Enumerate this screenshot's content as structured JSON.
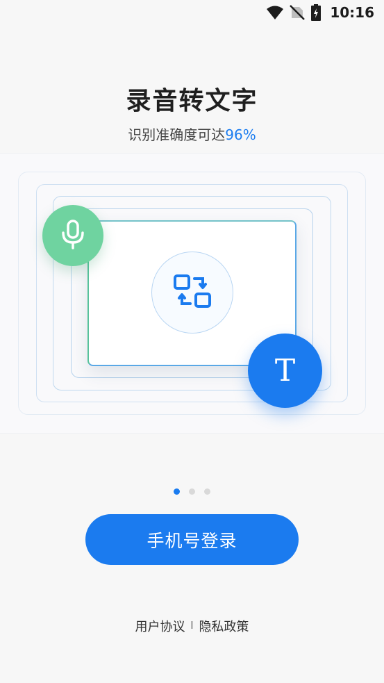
{
  "status_bar": {
    "time": "10:16",
    "icons": [
      "wifi-icon",
      "no-sim-icon",
      "battery-charging-icon"
    ]
  },
  "header": {
    "title": "录音转文字",
    "subtitle_prefix": "识别准确度可达",
    "subtitle_accent": "96%"
  },
  "illustration": {
    "mic_icon": "microphone-icon",
    "convert_icon": "convert-icon",
    "text_glyph": "T"
  },
  "pager": {
    "count": 3,
    "active_index": 0
  },
  "login": {
    "button_label": "手机号登录"
  },
  "footer": {
    "user_agreement": "用户协议",
    "separator": "l",
    "privacy_policy": "隐私政策"
  },
  "colors": {
    "accent": "#1a7cf0",
    "mic_green": "#6fd3a0",
    "background": "#f7f7f7"
  }
}
